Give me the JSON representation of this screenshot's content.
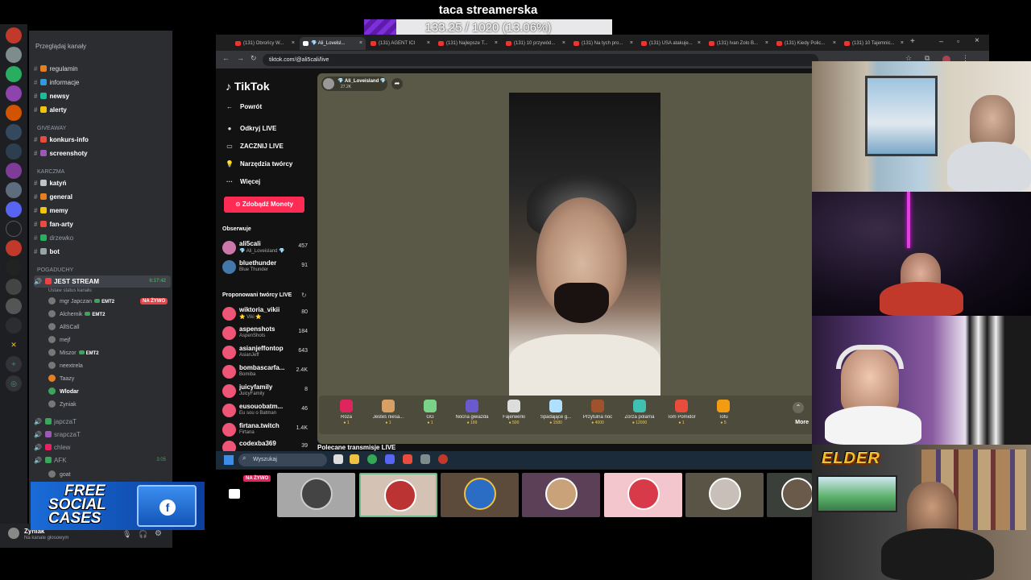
{
  "goal": {
    "title": "taca streamerska",
    "progress_text": "133.25 / 1020 (13.06%)",
    "fraction": 0.1306
  },
  "discord": {
    "browse_label": "Przeglądaj kanały",
    "channels": [
      {
        "name": "regulamin",
        "icon": "rules-icon",
        "color": "#e67e22"
      },
      {
        "name": "informacje",
        "icon": "info-icon",
        "color": "#3498db"
      },
      {
        "name": "newsy",
        "icon": "globe-icon",
        "color": "#1abc9c"
      },
      {
        "name": "alerty",
        "icon": "bell-icon",
        "color": "#f1c40f"
      }
    ],
    "category_giveaway": "GIVEAWAY",
    "giveaway_channels": [
      {
        "name": "konkurs-info",
        "icon": "gift-icon",
        "color": "#e74c3c"
      },
      {
        "name": "screenshoty",
        "icon": "camera-icon",
        "color": "#9b59b6"
      }
    ],
    "category_karczma": "KARCZMA",
    "karczma_channels": [
      {
        "name": "katyń",
        "icon": "skull-icon",
        "color": "#bdc3c7"
      },
      {
        "name": "general",
        "icon": "skull-icon",
        "color": "#e67e22"
      },
      {
        "name": "memy",
        "icon": "laugh-icon",
        "color": "#f1c40f"
      },
      {
        "name": "fan-arty",
        "icon": "palette-icon",
        "color": "#e74c3c"
      },
      {
        "name": "drzewko",
        "icon": "tree-icon",
        "color": "#27ae60"
      },
      {
        "name": "bot",
        "icon": "robot-icon",
        "color": "#95a5a6"
      }
    ],
    "category_pogaduchy": "POGADUCHY",
    "stream_channel": {
      "name": "JEST STREAM",
      "time": "6:17:42",
      "status": "Ustaw status kanału"
    },
    "voice_users": [
      {
        "name": "mgr Japczan",
        "badge": "EMT2",
        "live": "NA ŻYWO"
      },
      {
        "name": "Alchemik",
        "badge": "EMT2"
      },
      {
        "name": "AllSCall"
      },
      {
        "name": "mejf"
      },
      {
        "name": "Miszor",
        "badge": "EMT2"
      },
      {
        "name": "neextrela"
      },
      {
        "name": "Taazy"
      },
      {
        "name": "Wlodar"
      },
      {
        "name": "Zyniak"
      }
    ],
    "voice_channels": [
      {
        "name": "japczaT",
        "color": "#3ba55c"
      },
      {
        "name": "srapczaT",
        "color": "#9b59b6"
      },
      {
        "name": "chlew",
        "color": "#e91e63"
      },
      {
        "name": "AFK",
        "time": "3:05",
        "color": "#3ba55c"
      }
    ],
    "last_user": "goat",
    "user": {
      "name": "Zyniak",
      "status": "Na kanale głosowym"
    }
  },
  "ad": {
    "line1": "FREE",
    "line2": "SOCIAL",
    "line3": "CASES"
  },
  "browser": {
    "tabs": [
      "(131) Obrońcy W...",
      "💎 Ali_Lovelsl...",
      "(131) AGENT ICI",
      "(131) Najlepsze T...",
      "(131) 10 przywód...",
      "(131) Na tych pro...",
      "(131) USA atakuje...",
      "(131) Ivan Zolo B...",
      "(131) Kiedy Polic...",
      "(131) 10 Tajemnic..."
    ],
    "url": "tiktok.com/@ali5cali/live"
  },
  "tiktok": {
    "logo": "TikTok",
    "nav": [
      {
        "label": "Powrót",
        "icon": "arrow-left-icon"
      },
      {
        "label": "Odkryj LIVE",
        "icon": "live-avatar-icon"
      },
      {
        "label": "ZACZNIJ LIVE",
        "icon": "camera-icon"
      },
      {
        "label": "Narzędzia twórcy",
        "icon": "lightbulb-icon"
      },
      {
        "label": "Więcej",
        "icon": "more-icon"
      }
    ],
    "coins_button": "Zdobądź Monety",
    "following_title": "Obserwuje",
    "following": [
      {
        "name": "ali5cali",
        "sub": "💎 Ali_Loveisland 💎",
        "count": "457"
      },
      {
        "name": "bluethunder",
        "sub": "Blue  Thunder",
        "count": "91"
      }
    ],
    "suggested_title": "Proponowani twórcy LIVE",
    "suggested": [
      {
        "name": "wiktoria_vikii",
        "sub": "⭐ Viki ⭐",
        "count": "80"
      },
      {
        "name": "aspenshots",
        "sub": "AspenShots",
        "count": "184"
      },
      {
        "name": "asianjeffontop",
        "sub": "AsianJeff",
        "count": "643"
      },
      {
        "name": "bombascarfa...",
        "sub": "Bomiba",
        "count": "2.4K"
      },
      {
        "name": "juicyfamily",
        "sub": "JuicyFamily",
        "count": "8"
      },
      {
        "name": "eusouobatm...",
        "sub": "Eu sou o Batman",
        "count": "46"
      },
      {
        "name": "firtana.twitch",
        "sub": "Firtana",
        "count": "1.4K"
      },
      {
        "name": "codexba369",
        "sub": "",
        "count": "39"
      }
    ],
    "host": {
      "name": "💎 Ali_Loveisland 💎",
      "count": "27.2K"
    },
    "gifts": [
      {
        "name": "Róża",
        "price": "1",
        "color": "#e0245e"
      },
      {
        "name": "Jesteś niesa...",
        "price": "1",
        "color": "#d9a066"
      },
      {
        "name": "GG",
        "price": "1",
        "color": "#7bd389"
      },
      {
        "name": "Nocna gwiazda",
        "price": "199",
        "color": "#6a5acd"
      },
      {
        "name": "Fajerwerki",
        "price": "500",
        "color": "#dddddd"
      },
      {
        "name": "Spadające g...",
        "price": "1580",
        "color": "#b0e0ff"
      },
      {
        "name": "Przytulna noc",
        "price": "4000",
        "color": "#a0522d"
      },
      {
        "name": "Zorza polarna",
        "price": "12000",
        "color": "#40c0b0"
      },
      {
        "name": "Tom Pomidor",
        "price": "1",
        "color": "#e74c3c"
      },
      {
        "name": "Tofu",
        "price": "5",
        "color": "#f39c12"
      }
    ],
    "more_label": "More",
    "recommended_title": "Polecane transmisje LIVE"
  },
  "taskbar": {
    "search_placeholder": "Wyszukaj"
  },
  "strip": {
    "live_label": "NA ŻYWO"
  },
  "cams": {
    "overlay_text": "ELDER"
  }
}
